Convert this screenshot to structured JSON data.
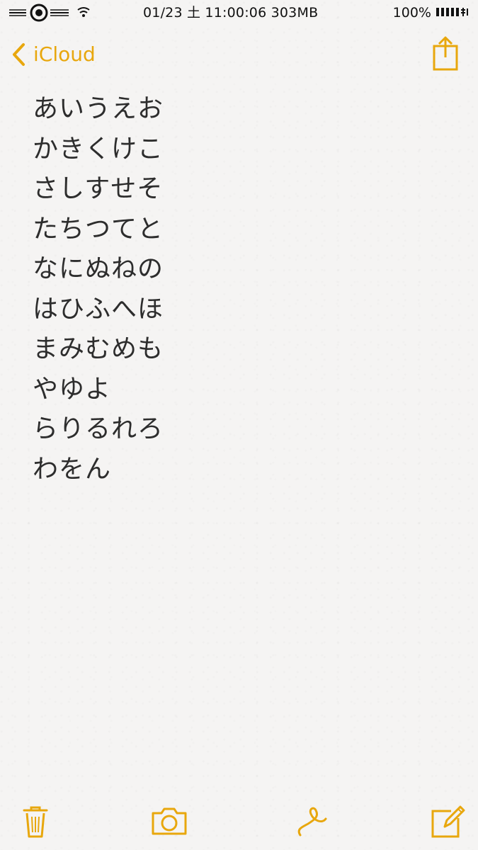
{
  "status_bar": {
    "date_time_memory": "01/23 土 11:00:06  303MB",
    "battery_percent": "100%"
  },
  "navigation": {
    "back_label": "iCloud",
    "back_icon": "chevron-left-icon",
    "share_icon": "share-icon"
  },
  "note": {
    "lines": [
      "あいうえお",
      "かきくけこ",
      "さしすせそ",
      "たちつてと",
      "なにぬねの",
      "はひふへほ",
      "まみむめも",
      "やゆよ",
      "らりるれろ",
      "わをん"
    ]
  },
  "toolbar": {
    "items": [
      {
        "icon": "trash-icon"
      },
      {
        "icon": "camera-icon"
      },
      {
        "icon": "sketch-icon"
      },
      {
        "icon": "compose-icon"
      }
    ]
  },
  "colors": {
    "accent": "#e8a70d",
    "background": "#f5f4f3",
    "text": "#2d2d2d"
  }
}
